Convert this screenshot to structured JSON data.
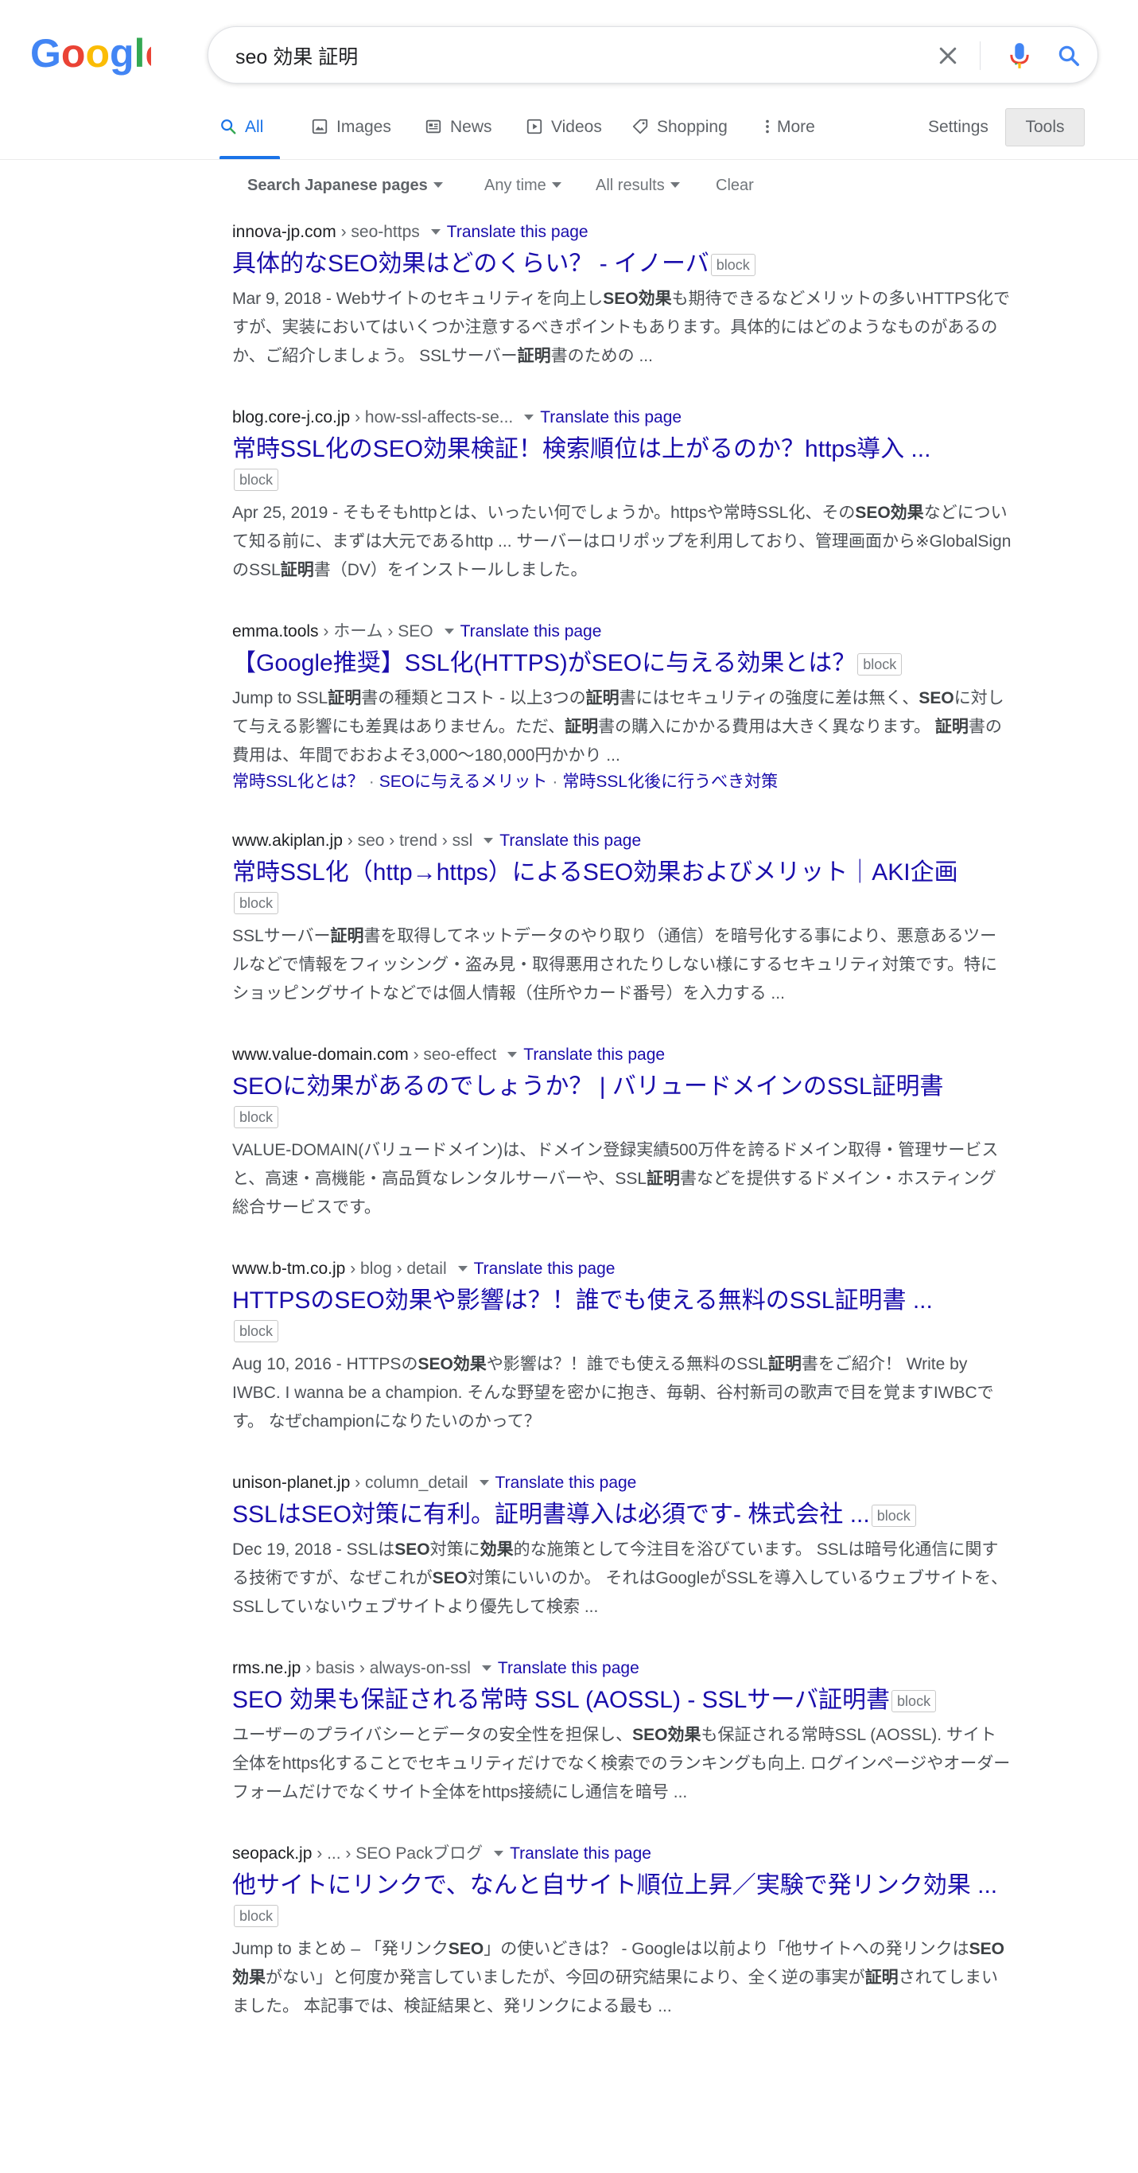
{
  "search": {
    "query": "seo 効果 証明"
  },
  "tabs": {
    "all": "All",
    "images": "Images",
    "news": "News",
    "videos": "Videos",
    "shopping": "Shopping",
    "more": "More",
    "settings": "Settings",
    "tools": "Tools"
  },
  "filters": {
    "language": "Search Japanese pages",
    "time": "Any time",
    "results": "All results",
    "clear": "Clear"
  },
  "translate_label": "Translate this page",
  "block_label": "block",
  "results": [
    {
      "site": "innova-jp.com",
      "path": " › seo-https",
      "title": "具体的なSEO効果はどのくらい？ - イノーバ",
      "snippet": [
        {
          "t": "Mar 9, 2018 - Webサイトのセキュリティを向上し",
          "b": false
        },
        {
          "t": "SEO効果",
          "b": true
        },
        {
          "t": "も期待できるなどメリットの多いHTTPS化ですが、実装においてはいくつか注意するべきポイントもあります。具体的にはどのようなものがあるのか、ご紹介しましょう。 SSLサーバー",
          "b": false
        },
        {
          "t": "証明",
          "b": true
        },
        {
          "t": "書のための ...",
          "b": false
        }
      ]
    },
    {
      "site": "blog.core-j.co.jp",
      "path": " › how-ssl-affects-se...",
      "title": "常時SSL化のSEO効果検証！検索順位は上がるのか？https導入 ...",
      "snippet": [
        {
          "t": "Apr 25, 2019 - そもそもhttpとは、いったい何でしょうか。httpsや常時SSL化、その",
          "b": false
        },
        {
          "t": "SEO効果",
          "b": true
        },
        {
          "t": "などについて知る前に、まずは大元であるhttp ... サーバーはロリポップを利用しており、管理画面から※GlobalSignのSSL",
          "b": false
        },
        {
          "t": "証明",
          "b": true
        },
        {
          "t": "書（DV）をインストールしました。",
          "b": false
        }
      ]
    },
    {
      "site": "emma.tools",
      "path": " › ホーム › SEO",
      "title": "【Google推奨】SSL化(HTTPS)がSEOに与える効果とは？",
      "snippet": [
        {
          "t": "Jump to SSL",
          "b": false
        },
        {
          "t": "証明",
          "b": true
        },
        {
          "t": "書の種類とコスト - 以上3つの",
          "b": false
        },
        {
          "t": "証明",
          "b": true
        },
        {
          "t": "書にはセキュリティの強度に差は無く、",
          "b": false
        },
        {
          "t": "SEO",
          "b": true
        },
        {
          "t": "に対して与える影響にも差異はありません。ただ、",
          "b": false
        },
        {
          "t": "証明",
          "b": true
        },
        {
          "t": "書の購入にかかる費用は大きく異なります。 ",
          "b": false
        },
        {
          "t": "証明",
          "b": true
        },
        {
          "t": "書の費用は、年間でおおよそ3,000〜180,000円かかり ...",
          "b": false
        }
      ],
      "sitelinks": [
        "常時SSL化とは？",
        "SEOに与えるメリット",
        "常時SSL化後に行うべき対策"
      ]
    },
    {
      "site": "www.akiplan.jp",
      "path": " › seo › trend › ssl",
      "title": "常時SSL化（http→https）によるSEO効果およびメリット｜AKI企画",
      "snippet": [
        {
          "t": "SSLサーバー",
          "b": false
        },
        {
          "t": "証明",
          "b": true
        },
        {
          "t": "書を取得してネットデータのやり取り（通信）を暗号化する事により、悪意あるツールなどで情報をフィッシング・盗み見・取得悪用されたりしない様にするセキュリティ対策です。特にショッピングサイトなどでは個人情報（住所やカード番号）を入力する ...",
          "b": false
        }
      ]
    },
    {
      "site": "www.value-domain.com",
      "path": " › seo-effect",
      "title": "SEOに効果があるのでしょうか？ | バリュードメインのSSL証明書",
      "snippet": [
        {
          "t": "VALUE-DOMAIN(バリュードメイン)は、ドメイン登録実績500万件を誇るドメイン取得・管理サービスと、高速・高機能・高品質なレンタルサーバーや、SSL",
          "b": false
        },
        {
          "t": "証明",
          "b": true
        },
        {
          "t": "書などを提供するドメイン・ホスティング総合サービスです。",
          "b": false
        }
      ]
    },
    {
      "site": "www.b-tm.co.jp",
      "path": " › blog › detail",
      "title": "HTTPSのSEO効果や影響は？！誰でも使える無料のSSL証明書 ...",
      "snippet": [
        {
          "t": "Aug 10, 2016 - HTTPSの",
          "b": false
        },
        {
          "t": "SEO効果",
          "b": true
        },
        {
          "t": "や影響は？！誰でも使える無料のSSL",
          "b": false
        },
        {
          "t": "証明",
          "b": true
        },
        {
          "t": "書をご紹介！ Write by IWBC. I wanna be a champion. そんな野望を密かに抱き、毎朝、谷村新司の歌声で目を覚ますIWBCです。 なぜchampionになりたいのかって？",
          "b": false
        }
      ]
    },
    {
      "site": "unison-planet.jp",
      "path": " › column_detail",
      "title": "SSLはSEO対策に有利。証明書導入は必須です- 株式会社 ...",
      "snippet": [
        {
          "t": "Dec 19, 2018 - SSLは",
          "b": false
        },
        {
          "t": "SEO",
          "b": true
        },
        {
          "t": "対策に",
          "b": false
        },
        {
          "t": "効果",
          "b": true
        },
        {
          "t": "的な施策として今注目を浴びています。 SSLは暗号化通信に関する技術ですが、なぜこれが",
          "b": false
        },
        {
          "t": "SEO",
          "b": true
        },
        {
          "t": "対策にいいのか。 それはGoogleがSSLを導入しているウェブサイトを、SSLしていないウェブサイトより優先して検索 ...",
          "b": false
        }
      ]
    },
    {
      "site": "rms.ne.jp",
      "path": " › basis › always-on-ssl",
      "title": "SEO 効果も保証される常時 SSL (AOSSL) - SSLサーバ証明書",
      "snippet": [
        {
          "t": "ユーザーのプライバシーとデータの安全性を担保し、",
          "b": false
        },
        {
          "t": "SEO効果",
          "b": true
        },
        {
          "t": "も保証される常時SSL (AOSSL). サイト全体をhttps化することでセキュリティだけでなく検索でのランキングも向上. ログインページやオーダーフォームだけでなくサイト全体をhttps接続にし通信を暗号 ...",
          "b": false
        }
      ]
    },
    {
      "site": "seopack.jp",
      "path": " › ... › SEO Packブログ",
      "title": "他サイトにリンクで、なんと自サイト順位上昇／実験で発リンク効果 ...",
      "snippet": [
        {
          "t": "Jump to まとめ – 「発リンク",
          "b": false
        },
        {
          "t": "SEO",
          "b": true
        },
        {
          "t": "」の使いどきは？ - Googleは以前より「他サイトへの発リンクは",
          "b": false
        },
        {
          "t": "SEO効果",
          "b": true
        },
        {
          "t": "がない」と何度か発言していましたが、今回の研究結果により、全く逆の事実が",
          "b": false
        },
        {
          "t": "証明",
          "b": true
        },
        {
          "t": "されてしまいました。 本記事では、検証結果と、発リンクによる最も ...",
          "b": false
        }
      ]
    }
  ]
}
